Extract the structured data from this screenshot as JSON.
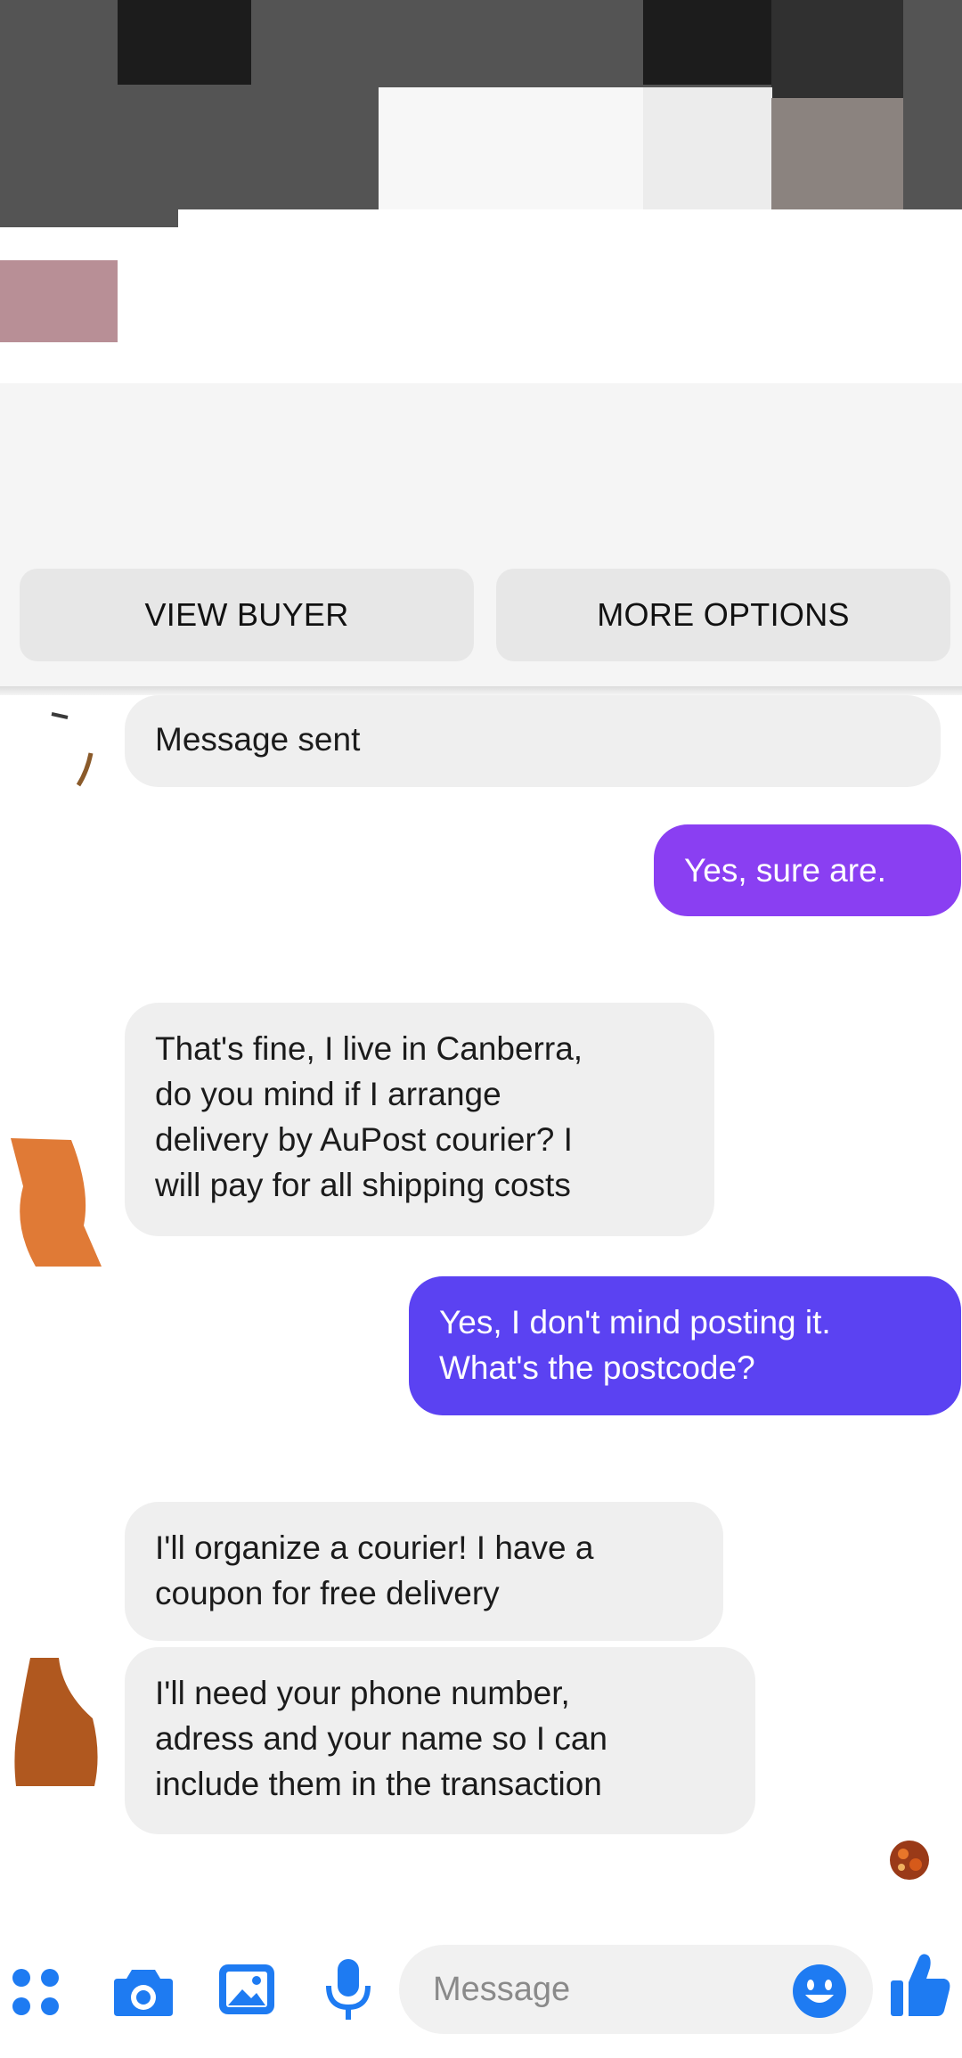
{
  "colors": {
    "outgoing_bubble_purple": "#8a3ff2",
    "outgoing_bubble_blue": "#5b42f2",
    "incoming_bubble": "#efefef",
    "accent_blue": "#1e7bf2"
  },
  "action_bar": {
    "view_buyer_label": "VIEW BUYER",
    "more_options_label": "MORE OPTIONS"
  },
  "messages": [
    {
      "direction": "incoming",
      "text": "Message sent"
    },
    {
      "direction": "outgoing",
      "text": "Yes, sure are."
    },
    {
      "direction": "incoming",
      "text": "That's fine, I live in Canberra,\ndo you mind if I arrange\ndelivery by AuPost courier? I\nwill pay for all shipping costs"
    },
    {
      "direction": "outgoing",
      "text": "Yes, I don't mind posting it.\nWhat's the postcode?"
    },
    {
      "direction": "incoming",
      "text": "I'll organize a courier! I have a\ncoupon for free delivery"
    },
    {
      "direction": "incoming",
      "text": "I'll need your phone number,\nadress and your name so I can\ninclude them in the transaction"
    }
  ],
  "composer": {
    "placeholder": "Message",
    "icons": [
      "apps-grid-icon",
      "camera-icon",
      "gallery-icon",
      "microphone-icon",
      "emoji-icon",
      "thumbs-up-icon"
    ]
  }
}
